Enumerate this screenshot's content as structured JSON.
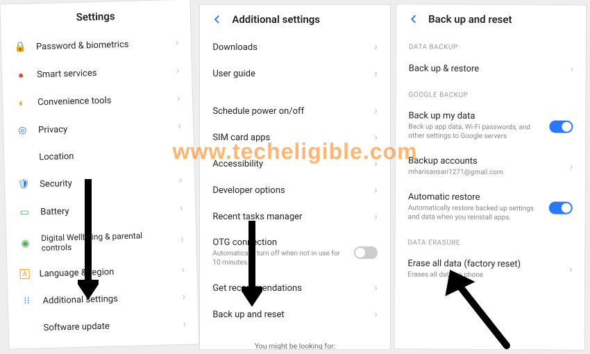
{
  "watermark": "www.techeligible.com",
  "panel1": {
    "title": "Settings",
    "items": [
      {
        "label": "Password & biometrics",
        "icon_color": "#2979ff"
      },
      {
        "label": "Smart services",
        "icon_color": "#f44336"
      },
      {
        "label": "Convenience tools",
        "icon_color": "#ff9800"
      },
      {
        "label": "Privacy",
        "icon_color": "#2979ff"
      },
      {
        "label": "Location",
        "icon_color": "#f44336"
      },
      {
        "label": "Security",
        "icon_color": "#2979ff"
      },
      {
        "label": "Battery",
        "icon_color": "#4caf50"
      },
      {
        "label": "Digital Wellbeing & parental controls",
        "icon_color": "#4caf50"
      },
      {
        "label": "Language & region",
        "icon_color": "#ff9800"
      },
      {
        "label": "Additional settings",
        "icon_color": "#2979ff"
      },
      {
        "label": "Software update",
        "icon_color": "#666"
      }
    ]
  },
  "panel2": {
    "title": "Additional settings",
    "items_g1": [
      {
        "label": "Downloads"
      },
      {
        "label": "User guide"
      }
    ],
    "items_g2": [
      {
        "label": "Schedule power on/off"
      },
      {
        "label": "SIM card apps"
      },
      {
        "label": "Accessibility"
      },
      {
        "label": "Developer options"
      },
      {
        "label": "Recent tasks manager"
      },
      {
        "label": "OTG connection",
        "sub": "Automatically turn off when not in use for 10 minutes.",
        "toggle": "off"
      },
      {
        "label": "Get recommendations"
      },
      {
        "label": "Back up and reset"
      }
    ],
    "footnote": "You might be looking for:"
  },
  "panel3": {
    "title": "Back up and reset",
    "section1": "DATA BACKUP",
    "items_s1": [
      {
        "label": "Back up & restore"
      }
    ],
    "section2": "GOOGLE BACKUP",
    "items_s2": [
      {
        "label": "Back up my data",
        "sub": "Back up app data, Wi-Fi passwords, and other settings to Google servers",
        "toggle": "on"
      },
      {
        "label": "Backup accounts",
        "sub": "mharisansari1271@gmail.com"
      },
      {
        "label": "Automatic restore",
        "sub": "Automatically restore backed up settings and data when you reinstall apps.",
        "toggle": "on"
      }
    ],
    "section3": "DATA ERASURE",
    "items_s3": [
      {
        "label": "Erase all data (factory reset)",
        "sub": "Erases all data on phone"
      }
    ]
  }
}
